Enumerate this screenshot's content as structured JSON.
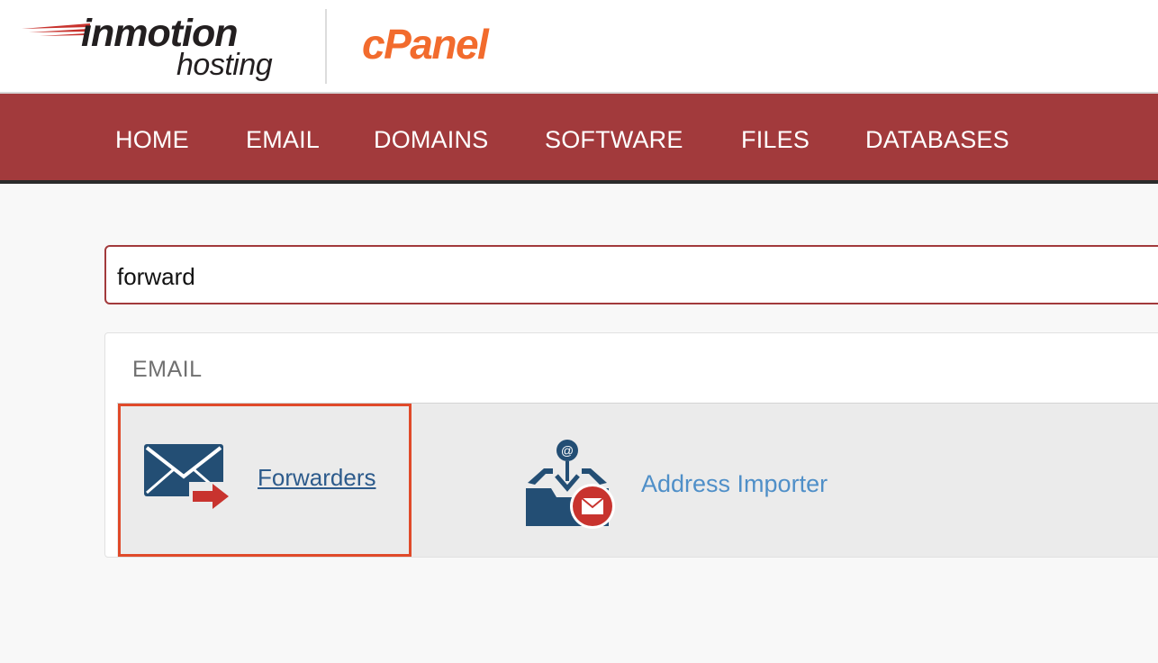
{
  "header": {
    "brand_word_1": "inmotion",
    "brand_word_2": "hosting",
    "product": "cPanel"
  },
  "nav": {
    "items": [
      "HOME",
      "EMAIL",
      "DOMAINS",
      "SOFTWARE",
      "FILES",
      "DATABASES"
    ]
  },
  "search": {
    "value": "forward"
  },
  "results": {
    "section_title": "EMAIL",
    "items": [
      {
        "label": "Forwarders",
        "icon": "envelope-forward-icon",
        "highlighted": true
      },
      {
        "label": "Address Importer",
        "icon": "address-importer-icon",
        "highlighted": false
      }
    ]
  },
  "colors": {
    "nav_bg": "#a23a3c",
    "highlight_border": "#e04a2a",
    "link": "#2d5b8c",
    "link_light": "#4f8fc8",
    "cpanel_orange": "#f26b2d"
  }
}
